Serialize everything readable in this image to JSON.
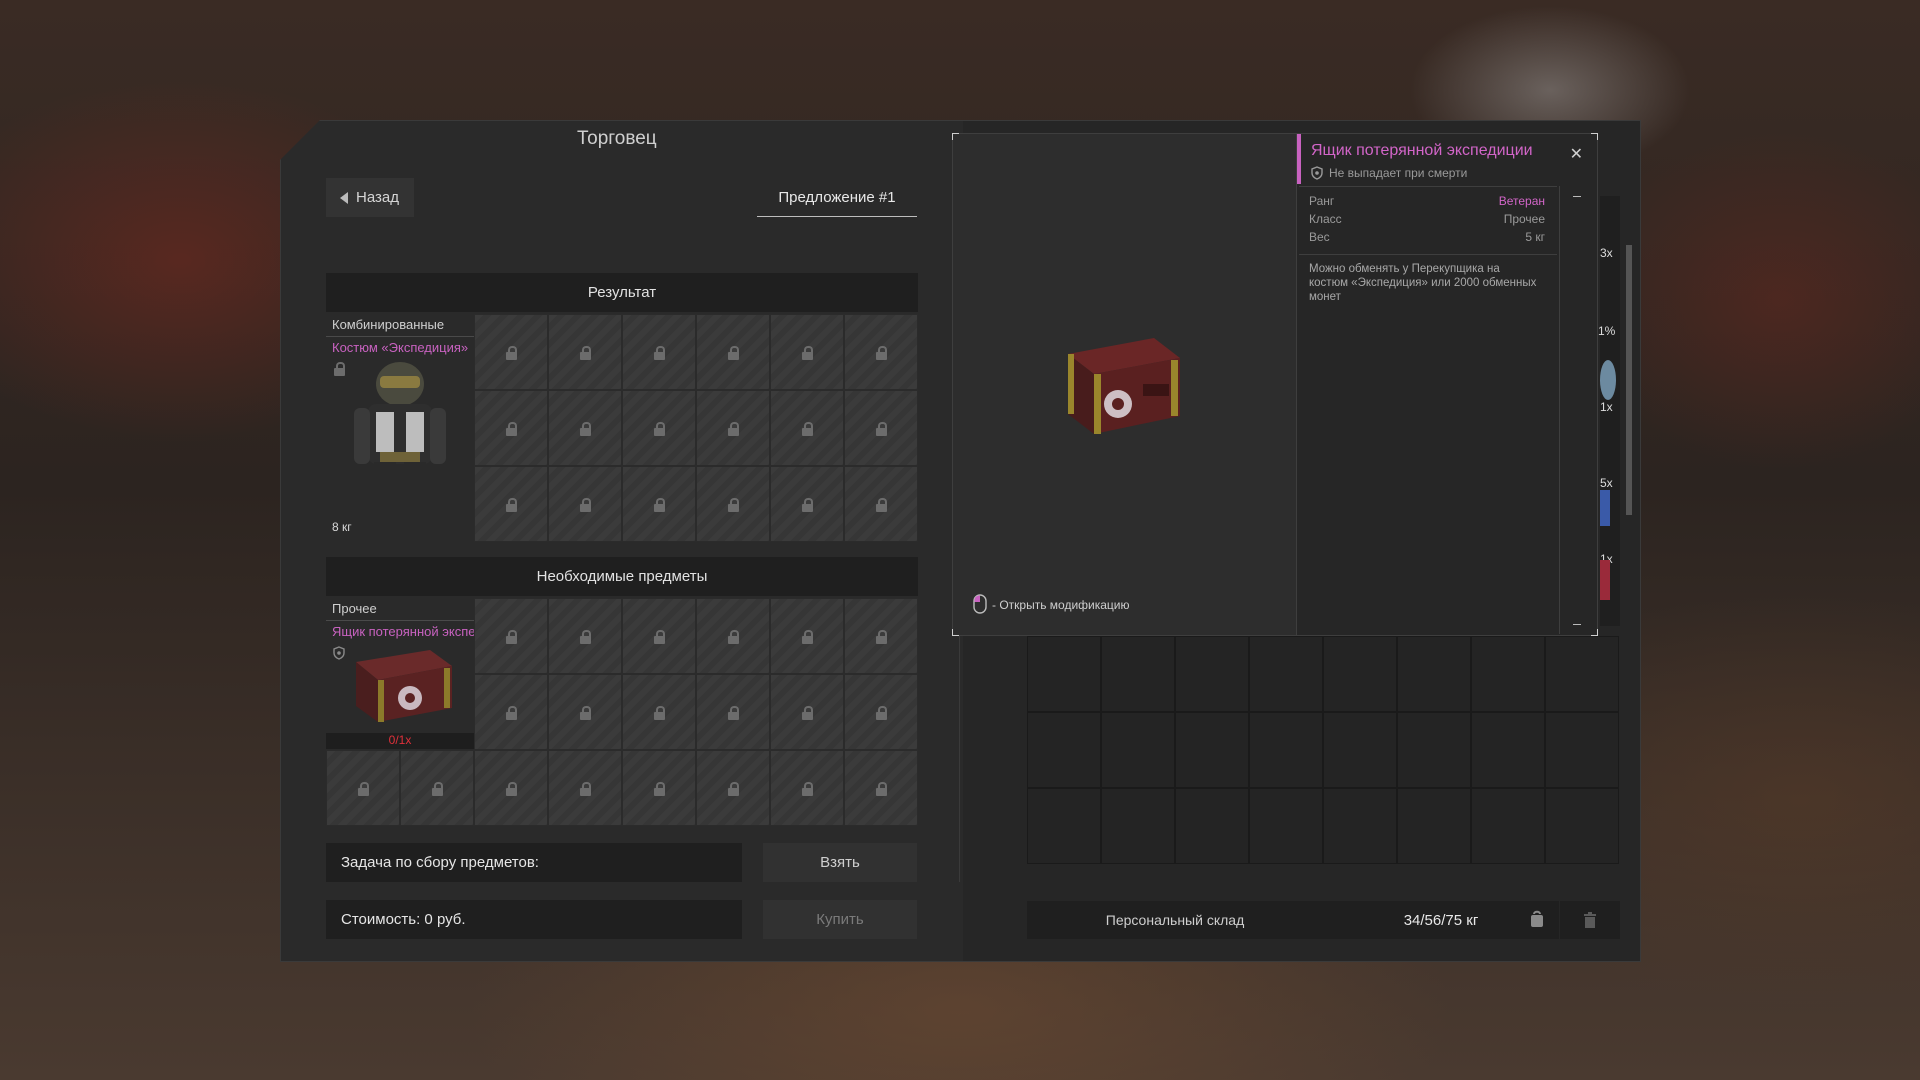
{
  "trader": {
    "title": "Торговец",
    "back_label": "Назад",
    "offer_tab": "Предложение #1",
    "result": {
      "header": "Результат",
      "category": "Комбинированные",
      "item_name": "Костюм «Экспедиция»",
      "weight": "8 кг"
    },
    "required": {
      "header": "Необходимые предметы",
      "category": "Прочее",
      "item_name": "Ящик потерянной экспедиции",
      "count": "0/1x"
    },
    "task_label": "Задача по сбору предметов:",
    "take_button": "Взять",
    "cost_label": "Стоимость: 0 руб.",
    "buy_button": "Купить"
  },
  "tooltip": {
    "title": "Ящик потерянной экспедиции",
    "no_drop": "Не выпадает при смерти",
    "stats": [
      {
        "label": "Ранг",
        "value": "Ветеран"
      },
      {
        "label": "Класс",
        "value": "Прочее"
      },
      {
        "label": "Вес",
        "value": "5 кг"
      }
    ],
    "description": "Можно обменять у Перекупщика на костюм «Экспедиция» или 2000 обменных монет",
    "hint": "- Открыть модификацию",
    "rank_color": "#d265c8"
  },
  "stash": {
    "label": "Персональный склад",
    "weight": "34/56/75 кг",
    "side_counts": [
      "3x",
      "1%",
      "1x",
      "5x",
      "1x"
    ]
  },
  "colors": {
    "accent": "#c862c0",
    "danger": "#e0303a"
  }
}
